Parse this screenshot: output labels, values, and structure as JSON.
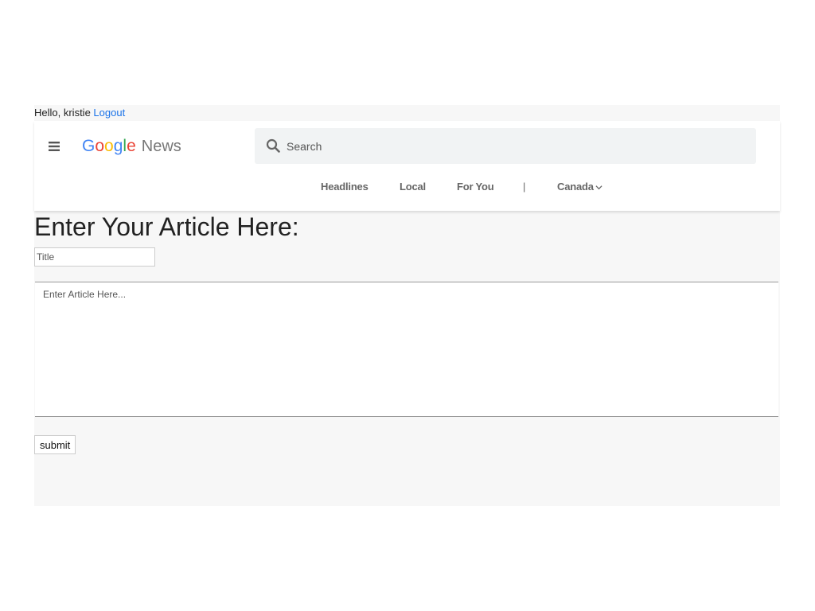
{
  "user_bar": {
    "greeting": "Hello, kristie",
    "logout_label": "Logout"
  },
  "header": {
    "logo": {
      "google_letters": [
        {
          "char": "G",
          "color": "#4285F4"
        },
        {
          "char": "o",
          "color": "#EA4335"
        },
        {
          "char": "o",
          "color": "#FBBC05"
        },
        {
          "char": "g",
          "color": "#4285F4"
        },
        {
          "char": "l",
          "color": "#34A853"
        },
        {
          "char": "e",
          "color": "#EA4335"
        }
      ],
      "product": "News"
    },
    "menu_icon": "hamburger-menu-icon",
    "search": {
      "icon": "search-icon",
      "placeholder": "Search",
      "value": ""
    },
    "nav": {
      "items": [
        "Headlines",
        "Local",
        "For You"
      ],
      "separator": "|",
      "region_label": "Canada",
      "region_icon": "chevron-down-icon"
    }
  },
  "editor": {
    "title": "Enter Your Article Here:",
    "title_placeholder": "Title",
    "title_value": "",
    "article_placeholder": "Enter Article Here...",
    "article_value": "",
    "submit_label": "submit"
  },
  "colors": {
    "link": "#1a73e8",
    "panel_background": "#f7f7f7",
    "search_background": "#f1f3f4",
    "nav_text": "#666666"
  }
}
